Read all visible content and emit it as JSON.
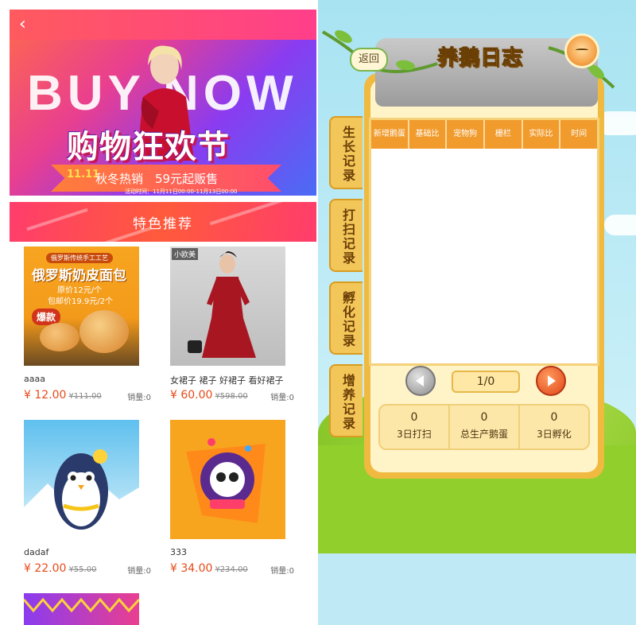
{
  "shop": {
    "banner": {
      "big_text": "BUY NOW",
      "headline": "购物狂欢节",
      "date_badge": "11.11",
      "ribbon_text": "秋冬热销　59元起贩售",
      "activity_time": "活动时间：11月11日00:00-11月13日00:00",
      "back_icon": "chevron-left-icon"
    },
    "featured_title": "特色推荐",
    "products": [
      {
        "name": "aaaa",
        "price": "¥ 12.00",
        "old_price": "¥111.00",
        "sales": "销量:0",
        "img_title": "俄罗斯奶皮面包",
        "img_sub1": "原价12元/个",
        "img_sub2": "包邮价19.9元/2个",
        "img_badge": "爆款",
        "img_top": "俄罗斯传统手工工艺"
      },
      {
        "name": "女裙子 裙子 好裙子 看好裙子",
        "price": "¥ 60.00",
        "old_price": "¥598.00",
        "sales": "销量:0",
        "img_tag": "小欧美"
      },
      {
        "name": "dadaf",
        "price": "¥ 22.00",
        "old_price": "¥55.00",
        "sales": "销量:0"
      },
      {
        "name": "333",
        "price": "¥ 34.00",
        "old_price": "¥234.00",
        "sales": "销量:0"
      }
    ]
  },
  "game": {
    "title": "养鹅日志",
    "back_label": "返回",
    "table_headers": [
      "新增鹅蛋",
      "基础比",
      "宠物狗",
      "栅栏",
      "实际比",
      "时间"
    ],
    "side_tabs": [
      "生长记录",
      "打扫记录",
      "孵化记录",
      "增养记录"
    ],
    "page_indicator": "1/0",
    "stats": [
      {
        "value": "0",
        "label": "3日打扫"
      },
      {
        "value": "0",
        "label": "总生产鹅蛋"
      },
      {
        "value": "0",
        "label": "3日孵化"
      }
    ]
  },
  "colors": {
    "accent_orange": "#f19b2c",
    "price_red": "#e64a19",
    "banner_pink": "#ff3d6c"
  }
}
